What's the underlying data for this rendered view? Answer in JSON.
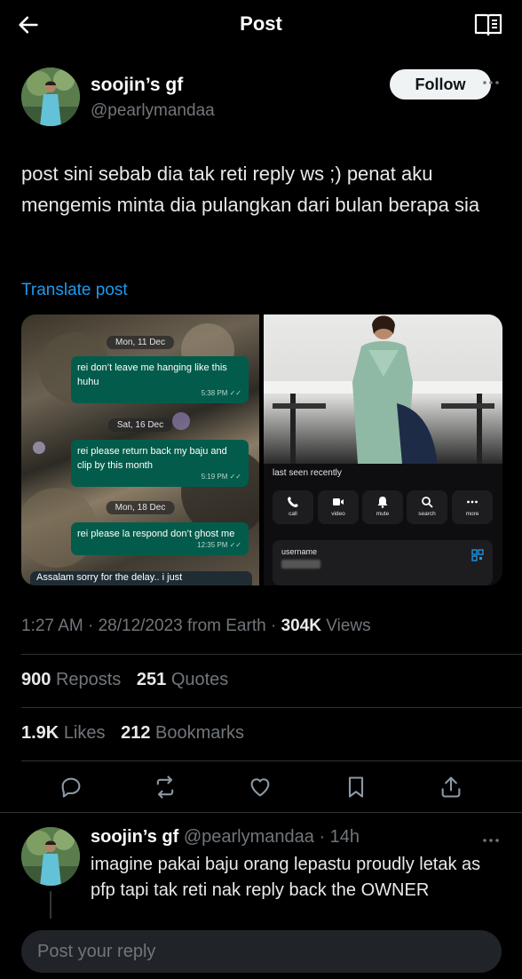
{
  "topbar": {
    "title": "Post"
  },
  "author": {
    "name": "soojin’s gf",
    "handle": "@pearlymandaa",
    "follow_label": "Follow"
  },
  "post": {
    "text": "post sini sebab dia tak reti reply ws ;) penat aku mengemis minta dia pulangkan dari bulan berapa sia",
    "translate_label": "Translate post"
  },
  "chat_screenshot": {
    "date1": "Mon, 11 Dec",
    "msg1": "rei don’t leave me hanging like this huhu",
    "time1": "5:38 PM ✓✓",
    "date2": "Sat, 16 Dec",
    "msg2": "rei please return back my baju and clip by this month",
    "time2": "5:19 PM ✓✓",
    "date3": "Mon, 18 Dec",
    "msg3": "rei please la respond don’t ghost me",
    "time3": "12:35 PM ✓✓",
    "incoming": "Assalam sorry for the delay.. i just"
  },
  "profile_screenshot": {
    "last_seen": "last seen recently",
    "actions": [
      "call",
      "video",
      "mute",
      "search",
      "more"
    ],
    "username_label": "username"
  },
  "meta": {
    "time": "1:27 AM",
    "date": "28/12/2023",
    "source": "from Earth",
    "views_count": "304K",
    "views_label": "Views"
  },
  "stats": {
    "reposts_count": "900",
    "reposts_label": "Reposts",
    "quotes_count": "251",
    "quotes_label": "Quotes",
    "likes_count": "1.9K",
    "likes_label": "Likes",
    "bookmarks_count": "212",
    "bookmarks_label": "Bookmarks"
  },
  "reply": {
    "name": "soojin’s gf",
    "handle": "@pearlymandaa",
    "time": "14h",
    "text": "imagine pakai baju orang lepastu proudly letak as pfp tapi tak reti nak reply back the OWNER"
  },
  "composer": {
    "placeholder": "Post your reply"
  },
  "colors": {
    "accent": "#1d9bf0",
    "background": "#000000",
    "secondary_text": "#71767b",
    "chat_bubble": "#035c4b"
  }
}
